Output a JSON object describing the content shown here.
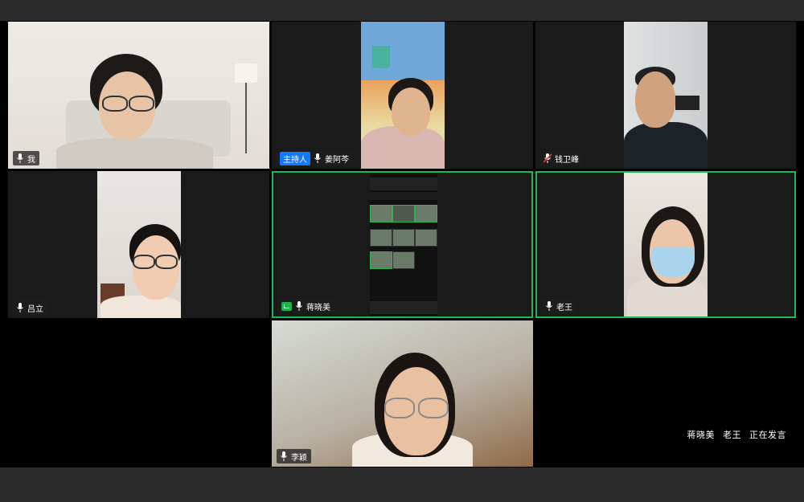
{
  "participants": [
    {
      "id": "me",
      "name": "我",
      "host": false,
      "speaking": false,
      "sharing": false,
      "mic": "on"
    },
    {
      "id": "jiang-ayun",
      "name": "姜阿芩",
      "host": true,
      "host_label": "主持人",
      "speaking": false,
      "sharing": false,
      "mic": "on"
    },
    {
      "id": "qian-weifeng",
      "name": "钱卫峰",
      "host": false,
      "speaking": false,
      "sharing": false,
      "mic": "muted"
    },
    {
      "id": "lv-li",
      "name": "吕立",
      "host": false,
      "speaking": false,
      "sharing": false,
      "mic": "on"
    },
    {
      "id": "jiang-xiaomei",
      "name": "蒋晓美",
      "host": false,
      "speaking": true,
      "sharing": true,
      "mic": "on"
    },
    {
      "id": "lao-wang",
      "name": "老王",
      "host": false,
      "speaking": true,
      "sharing": false,
      "mic": "on"
    },
    {
      "id": "li-ying",
      "name": "李颖",
      "host": false,
      "speaking": false,
      "sharing": false,
      "mic": "on"
    }
  ],
  "speaking_status": {
    "speakers": [
      "蒋晓美",
      "老王"
    ],
    "suffix": "正在发言"
  },
  "colors": {
    "speaking_border": "#1db954",
    "host_badge": "#1677ff",
    "share_badge": "#21b14b",
    "muted_icon": "#e0453a"
  },
  "icons": {
    "mic_on": "microphone-icon",
    "mic_muted": "microphone-muted-icon",
    "screen_share": "screen-share-icon"
  }
}
